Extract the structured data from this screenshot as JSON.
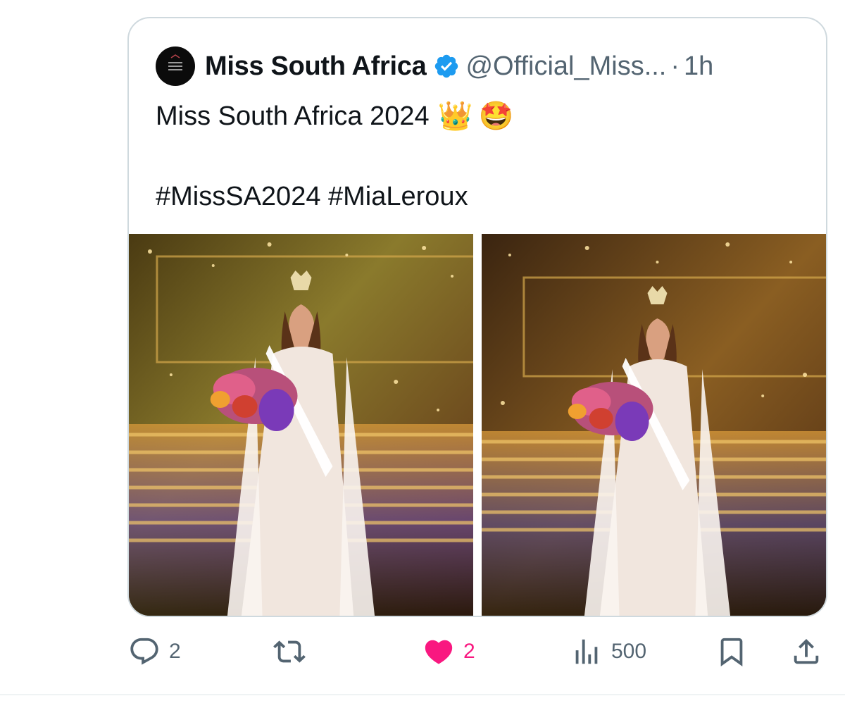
{
  "tweet": {
    "avatar_icon": "miss-south-africa-logo",
    "display_name": "Miss South Africa",
    "verified_icon": "verified-badge-icon",
    "handle": "@Official_Miss...",
    "separator": "·",
    "time": "1h",
    "text_line1": "Miss South Africa 2024",
    "emoji_crown": "👑",
    "emoji_star": "🤩",
    "hashtags": "#MissSA2024 #MiaLeroux",
    "photos": [
      {
        "name": "photo-winner-1",
        "icon": "photo"
      },
      {
        "name": "photo-winner-2",
        "icon": "photo"
      }
    ]
  },
  "actions": {
    "replies": "2",
    "reposts": "",
    "likes": "2",
    "views": "500",
    "like_color": "#f91880",
    "verified_color": "#1d9bf0",
    "icon_color": "#536471"
  }
}
